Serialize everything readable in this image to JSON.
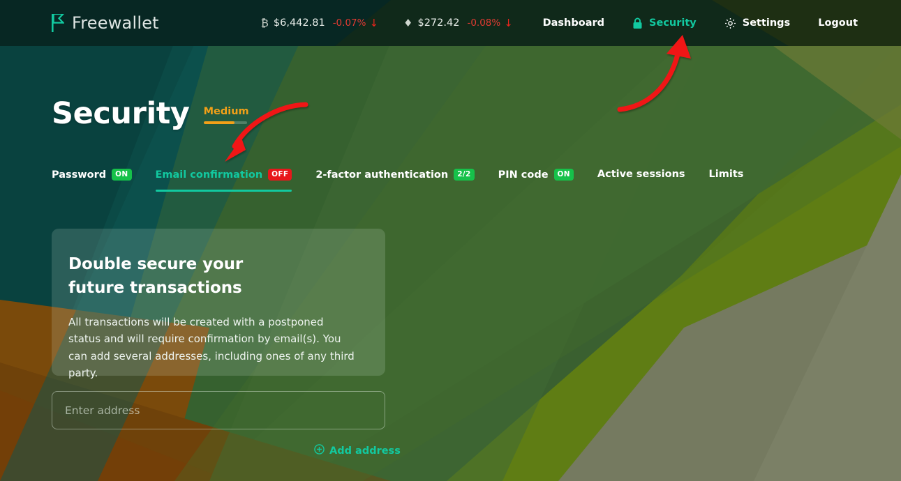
{
  "brand": {
    "name": "Freewallet",
    "mark": "flag-f-logo",
    "accent": "#12c9a0"
  },
  "tickers": [
    {
      "symbol": "₿",
      "icon": "bitcoin-icon",
      "price": "$6,442.81",
      "change": "-0.07%",
      "arrow": "↓",
      "direction": "down"
    },
    {
      "symbol": "♦",
      "icon": "ethereum-icon",
      "price": "$272.42",
      "change": "-0.08%",
      "arrow": "↓",
      "direction": "down"
    }
  ],
  "nav": [
    {
      "label": "Dashboard",
      "icon": null,
      "active": false
    },
    {
      "label": "Security",
      "icon": "lock-icon",
      "active": true
    },
    {
      "label": "Settings",
      "icon": "gear-icon",
      "active": false
    },
    {
      "label": "Logout",
      "icon": null,
      "active": false
    }
  ],
  "page": {
    "title": "Security",
    "strength_label": "Medium",
    "strength_percent": 72
  },
  "tabs": [
    {
      "label": "Password",
      "badge": "ON",
      "badge_type": "on",
      "active": false
    },
    {
      "label": "Email confirmation",
      "badge": "OFF",
      "badge_type": "off",
      "active": true
    },
    {
      "label": "2-factor authentication",
      "badge": "2/2",
      "badge_type": "count",
      "active": false
    },
    {
      "label": "PIN code",
      "badge": "ON",
      "badge_type": "on",
      "active": false
    },
    {
      "label": "Active sessions",
      "badge": null,
      "badge_type": null,
      "active": false
    },
    {
      "label": "Limits",
      "badge": null,
      "badge_type": null,
      "active": false
    }
  ],
  "card": {
    "title": "Double secure your future transactions",
    "body": "All transactions will be created with a postponed status and will require confirmation by email(s). You can add several addresses, including ones of any third party."
  },
  "address_form": {
    "placeholder": "Enter address",
    "value": "",
    "add_label": "Add address",
    "add_icon": "plus-circle-icon"
  },
  "annotations": [
    {
      "name": "arrow-to-security-nav",
      "color": "#f01414",
      "points_to": "Security"
    },
    {
      "name": "arrow-to-email-confirmation-tab",
      "color": "#f01414",
      "points_to": "Email confirmation"
    }
  ],
  "colors": {
    "accent_teal": "#12c9a0",
    "badge_on": "#16c14a",
    "badge_off": "#e8171b",
    "strength_orange": "#f2a018",
    "annotation_red": "#f01414"
  }
}
